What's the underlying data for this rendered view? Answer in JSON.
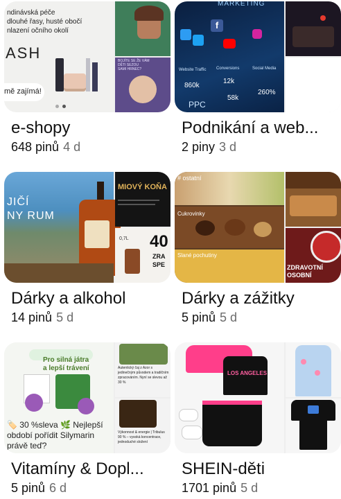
{
  "boards": [
    {
      "title": "e-shopy",
      "pins": "648 pinů",
      "age": "4 d",
      "thumb": {
        "main_lines": [
          "ndinávská péče",
          "dlouhé řasy, husté obočí",
          "nlazení očního okolí"
        ],
        "main_brand": "ASH",
        "main_cta": "mě zajímá!",
        "side2_lines": [
          "BOJÍTE SE ŽE VÁM",
          "DĚTI SEZOU",
          "SAMI HRNEC?"
        ]
      }
    },
    {
      "title": "Podnikání a web...",
      "pins": "2 piny",
      "age": "3 d",
      "thumb": {
        "main_header": "MARKETING",
        "main_stats": [
          "Website Traffic",
          "Conversions",
          "Social Media",
          "860k",
          "12k",
          "58k",
          "260%",
          "PPC"
        ]
      }
    },
    {
      "title": "Dárky a alkohol",
      "pins": "14 pinů",
      "age": "5 d",
      "thumb": {
        "main_lines": [
          "JIČÍ",
          "NY RUM"
        ],
        "side1_text": "MIOVÝ KOŇA",
        "side2_lines": [
          "0,7L",
          "40",
          "ZRA",
          "SPE"
        ]
      }
    },
    {
      "title": "Dárky a zážitky",
      "pins": "5 pinů",
      "age": "5 d",
      "thumb": {
        "main_labels": [
          "# ostatní",
          "Cukrovinky",
          "Slané pochutiny"
        ],
        "side2_lines": [
          "ZDRAVOTNÍ",
          "OSOBNÍ"
        ]
      }
    },
    {
      "title": "Vitamíny & Dopl...",
      "pins": "5 pinů",
      "age": "6 d",
      "thumb": {
        "main_headline": [
          "Pro silná játra",
          "a lepší trávení"
        ],
        "main_caption": "🏷️ 30 %sleva 🌿 Nejlepší období pořídit Silymarin právě teď?",
        "side1_caption": "Autentický čaj z Azor s jedinečným původem a tradičním zpracováním. Nyní se slevou až 30 %",
        "side2_caption": "Výkonnost & energie | Tribulus 90 % – vysoká koncentrace, jednoduché složení"
      }
    },
    {
      "title": "SHEIN-děti",
      "pins": "1701 pinů",
      "age": "5 d",
      "thumb": {
        "main_print": "LOS ANGELES"
      }
    }
  ],
  "colors": {
    "text": "#111111",
    "muted": "#6b6b6b",
    "background": "#ffffff"
  }
}
